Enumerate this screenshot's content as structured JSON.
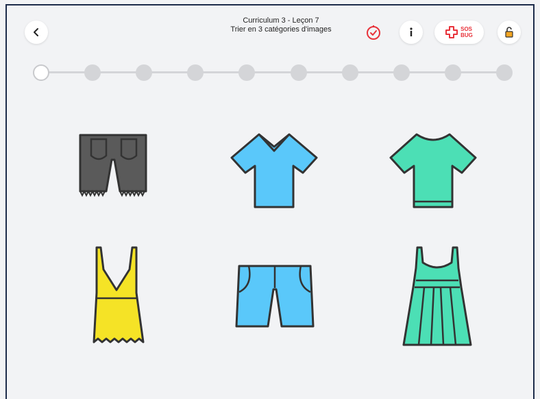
{
  "header": {
    "title_line1": "Curriculum 3 - Leçon 7",
    "title_line2": "Trier en 3 catégories d'images",
    "sos_line1": "SOS",
    "sos_line2": "BUG"
  },
  "icons": {
    "back": "chevron-left-icon",
    "timer": "timer-icon",
    "info": "info-icon",
    "sos": "medical-cross-icon",
    "lock": "unlock-icon"
  },
  "progress": {
    "total_steps": 10,
    "current_step": 1
  },
  "items": [
    {
      "name": "dark-shorts",
      "color": "#5a5a5a"
    },
    {
      "name": "blue-vneck-tshirt",
      "color": "#5ac8fa"
    },
    {
      "name": "green-tshirt",
      "color": "#4cdfb5"
    },
    {
      "name": "yellow-dress",
      "color": "#f5e326"
    },
    {
      "name": "blue-shorts",
      "color": "#5ac8fa"
    },
    {
      "name": "green-dress",
      "color": "#4cdfb5"
    }
  ],
  "colors": {
    "accent_red": "#e8323a",
    "accent_orange": "#f5a623",
    "outline": "#333333"
  }
}
